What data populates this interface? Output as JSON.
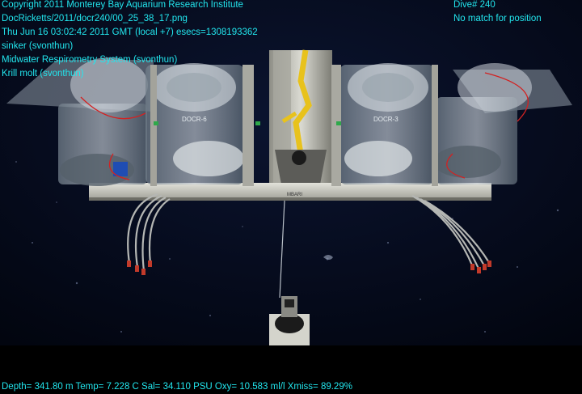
{
  "overlay": {
    "top_left": [
      "Copyright 2011 Monterey Bay Aquarium Research Institute",
      "DocRicketts/2011/docr240/00_25_38_17.png",
      "Thu Jun 16 03:02:42 2011 GMT (local +7)  esecs=1308193362",
      "sinker (svonthun)",
      "Midwater Respirometry System (svonthun)",
      "Krill molt (svonthun)"
    ],
    "top_right": [
      "Dive# 240",
      "No match for position"
    ],
    "bottom": "Depth= 341.80 m  Temp= 7.228 C  Sal= 34.110 PSU  Oxy= 10.583 ml/l  Xmiss= 89.29%"
  },
  "scene": {
    "chamber_labels": [
      "DOCR-6",
      "DOCR-3"
    ],
    "rail_label": "MBARI",
    "colors": {
      "overlay_text": "#22e6ee",
      "water": "#040918",
      "frame_metal": "#c9c9c0",
      "chamber_acrylic": "#a9b4bd",
      "cable_yellow": "#e8c21c",
      "tubing_red": "#d22222",
      "bottom_band": "#000000"
    }
  }
}
